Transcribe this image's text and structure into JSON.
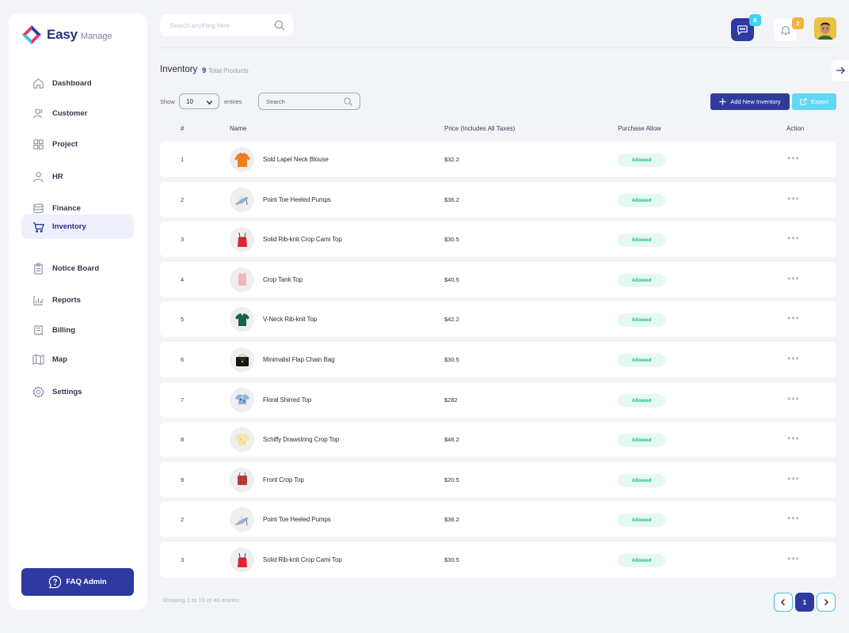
{
  "brand": {
    "name": "Easy",
    "sub": "Manage"
  },
  "sidebar": {
    "items": [
      {
        "label": "Dashboard",
        "icon": "home-icon"
      },
      {
        "label": "Customer",
        "icon": "users-icon"
      },
      {
        "label": "Project",
        "icon": "grid-icon"
      },
      {
        "label": "HR",
        "icon": "user-icon"
      },
      {
        "label": "Finance",
        "icon": "database-icon"
      },
      {
        "label": "Inventory",
        "icon": "cart-icon",
        "active": true
      },
      {
        "label": "Notice Board",
        "icon": "clipboard-icon"
      },
      {
        "label": "Reports",
        "icon": "bar-chart-icon"
      },
      {
        "label": "Billing",
        "icon": "receipt-icon"
      },
      {
        "label": "Map",
        "icon": "map-icon"
      },
      {
        "label": "Settings",
        "icon": "gear-icon"
      }
    ],
    "faq_label": "FAQ Admin"
  },
  "topbar": {
    "search_placeholder": "Search anything here",
    "messages_count": "8",
    "notifications_count": "2"
  },
  "page": {
    "title": "Inventory",
    "total_count": "9",
    "total_label": "Total Products"
  },
  "controls": {
    "show_label": "Show",
    "entries_value": "10",
    "entries_label": "entries",
    "search_placeholder": "Search",
    "add_label": "Add New Inventory",
    "export_label": "Export"
  },
  "table": {
    "headers": {
      "index": "#",
      "name": "Name",
      "price": "Price (Includes All Taxes)",
      "allow": "Purchase Allow",
      "action": "Action"
    },
    "rows": [
      {
        "idx": "1",
        "name": "Sold Lapel Neck Blouse",
        "price": "$32.2",
        "allow": "Allowed",
        "thumb": "orange-blouse"
      },
      {
        "idx": "2",
        "name": "Point Toe Heeled Pumps",
        "price": "$36.2",
        "allow": "Allowed",
        "thumb": "heeled-pumps"
      },
      {
        "idx": "3",
        "name": "Solid Rib-knit Crop Cami Top",
        "price": "$30.5",
        "allow": "Allowed",
        "thumb": "red-cami"
      },
      {
        "idx": "4",
        "name": "Crop Tank Top",
        "price": "$40.5",
        "allow": "Allowed",
        "thumb": "pink-tank"
      },
      {
        "idx": "5",
        "name": "V-Neck Rib-knit Top",
        "price": "$42.2",
        "allow": "Allowed",
        "thumb": "green-top"
      },
      {
        "idx": "6",
        "name": "Minimalist Flap Chain Bag",
        "price": "$30.5",
        "allow": "Allowed",
        "thumb": "black-bag"
      },
      {
        "idx": "7",
        "name": "Floral Shirred Top",
        "price": "$282",
        "allow": "Allowed",
        "thumb": "floral-top"
      },
      {
        "idx": "8",
        "name": "Schiffy Drawstring Crop Top",
        "price": "$46.2",
        "allow": "Allowed",
        "thumb": "yellow-top"
      },
      {
        "idx": "9",
        "name": "Front Crop Top",
        "price": "$20.5",
        "allow": "Allowed",
        "thumb": "plaid-top"
      },
      {
        "idx": "2",
        "name": "Point Toe Heeled Pumps",
        "price": "$36.2",
        "allow": "Allowed",
        "thumb": "heeled-pumps"
      },
      {
        "idx": "3",
        "name": "Solid Rib-knit Crop Cami Top",
        "price": "$30.5",
        "allow": "Allowed",
        "thumb": "red-cami"
      }
    ],
    "more_glyph": "•••"
  },
  "footer": {
    "showing_text": "Showing 1 to 10 of 40 entries",
    "current_page": "1"
  },
  "colors": {
    "primary": "#2e3a9f",
    "accent_cyan": "#60d8f4",
    "allowed_text": "#1fb885",
    "allowed_bg": "#e6f8f2"
  }
}
